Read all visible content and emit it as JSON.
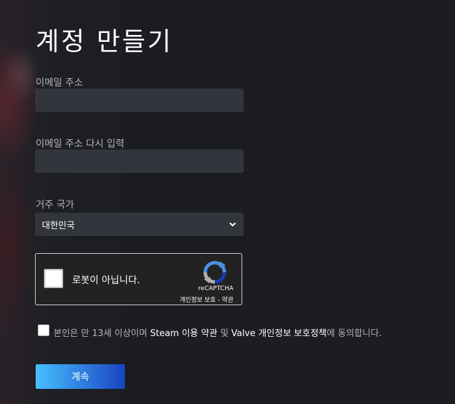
{
  "page": {
    "title": "계정 만들기"
  },
  "form": {
    "email_label": "이메일 주소",
    "email_value": "",
    "confirm_email_label": "이메일 주소 다시 입력",
    "confirm_email_value": "",
    "country_label": "거주 국가",
    "country_selected": "대한민국"
  },
  "captcha": {
    "text": "로봇이 아닙니다.",
    "brand": "reCAPTCHA",
    "links": "개인정보 보호 - 약관"
  },
  "agreement": {
    "part1": "본인은 만 13세 이상이며 ",
    "steam_terms": "Steam 이용 약관",
    "part2": " 및 ",
    "valve_privacy": "Valve 개인정보 보호정책",
    "part3": "에 동의합니다."
  },
  "buttons": {
    "continue_label": "계속"
  }
}
